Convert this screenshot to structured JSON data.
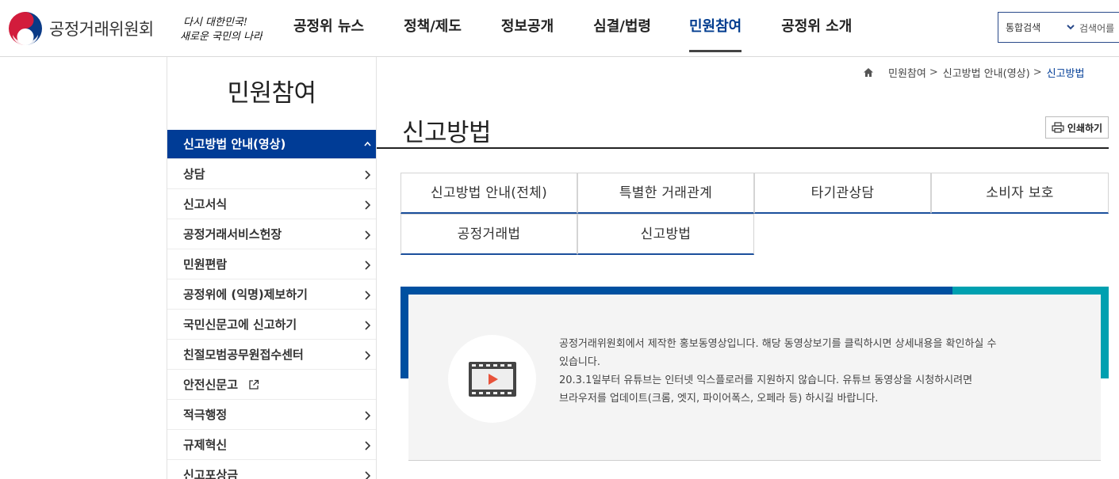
{
  "header": {
    "logo_text": "공정거래위원회",
    "slogan_line1": "다시 대한민국!",
    "slogan_line2": "새로운 국민의 나라",
    "nav": [
      {
        "label": "공정위 뉴스"
      },
      {
        "label": "정책/제도"
      },
      {
        "label": "정보공개"
      },
      {
        "label": "심결/법령"
      },
      {
        "label": "민원참여",
        "active": true
      },
      {
        "label": "공정위 소개"
      }
    ],
    "search": {
      "scope": "통합검색",
      "placeholder": "검색어를"
    }
  },
  "sidebar": {
    "title": "민원참여",
    "items": [
      {
        "label": "신고방법 안내(영상)",
        "active": true,
        "arrow": "up"
      },
      {
        "label": "상담",
        "arrow": "right"
      },
      {
        "label": "신고서식",
        "arrow": "right"
      },
      {
        "label": "공정거래서비스헌장",
        "arrow": "right"
      },
      {
        "label": "민원편람",
        "arrow": "right"
      },
      {
        "label": "공정위에 (익명)제보하기",
        "arrow": "right"
      },
      {
        "label": "국민신문고에 신고하기",
        "arrow": "right"
      },
      {
        "label": "친절모범공무원접수센터",
        "arrow": "right"
      },
      {
        "label": "안전신문고",
        "external": true
      },
      {
        "label": "적극행정",
        "arrow": "right"
      },
      {
        "label": "규제혁신",
        "arrow": "right"
      },
      {
        "label": "신고포상금",
        "arrow": "right"
      }
    ]
  },
  "breadcrumb": {
    "items": [
      "민원참여",
      "신고방법 안내(영상)",
      "신고방법"
    ]
  },
  "main": {
    "title": "신고방법",
    "print_label": "인쇄하기",
    "tabs": [
      {
        "label": "신고방법 안내(전체)"
      },
      {
        "label": "특별한 거래관계"
      },
      {
        "label": "타기관상담"
      },
      {
        "label": "소비자 보호"
      },
      {
        "label": "공정거래법"
      },
      {
        "label": "신고방법"
      }
    ],
    "video": {
      "desc_line1": "공정거래위원회에서 제작한 홍보동영상입니다. 해당 동영상보기를 클릭하시면 상세내용을 확인하실 수",
      "desc_line2": "있습니다.",
      "desc_line3": "20.3.1일부터 유튜브는 인터넷 익스플로러를 지원하지 않습니다. 유튜브 동영상을 시청하시려면",
      "desc_line4": "브라우저를 업데이트(크롬, 엣지, 파이어폭스, 오페라 등) 하시길 바랍니다."
    }
  },
  "colors": {
    "primary": "#003c96",
    "accent_blue": "#0050a0",
    "accent_teal": "#00a0b0"
  }
}
